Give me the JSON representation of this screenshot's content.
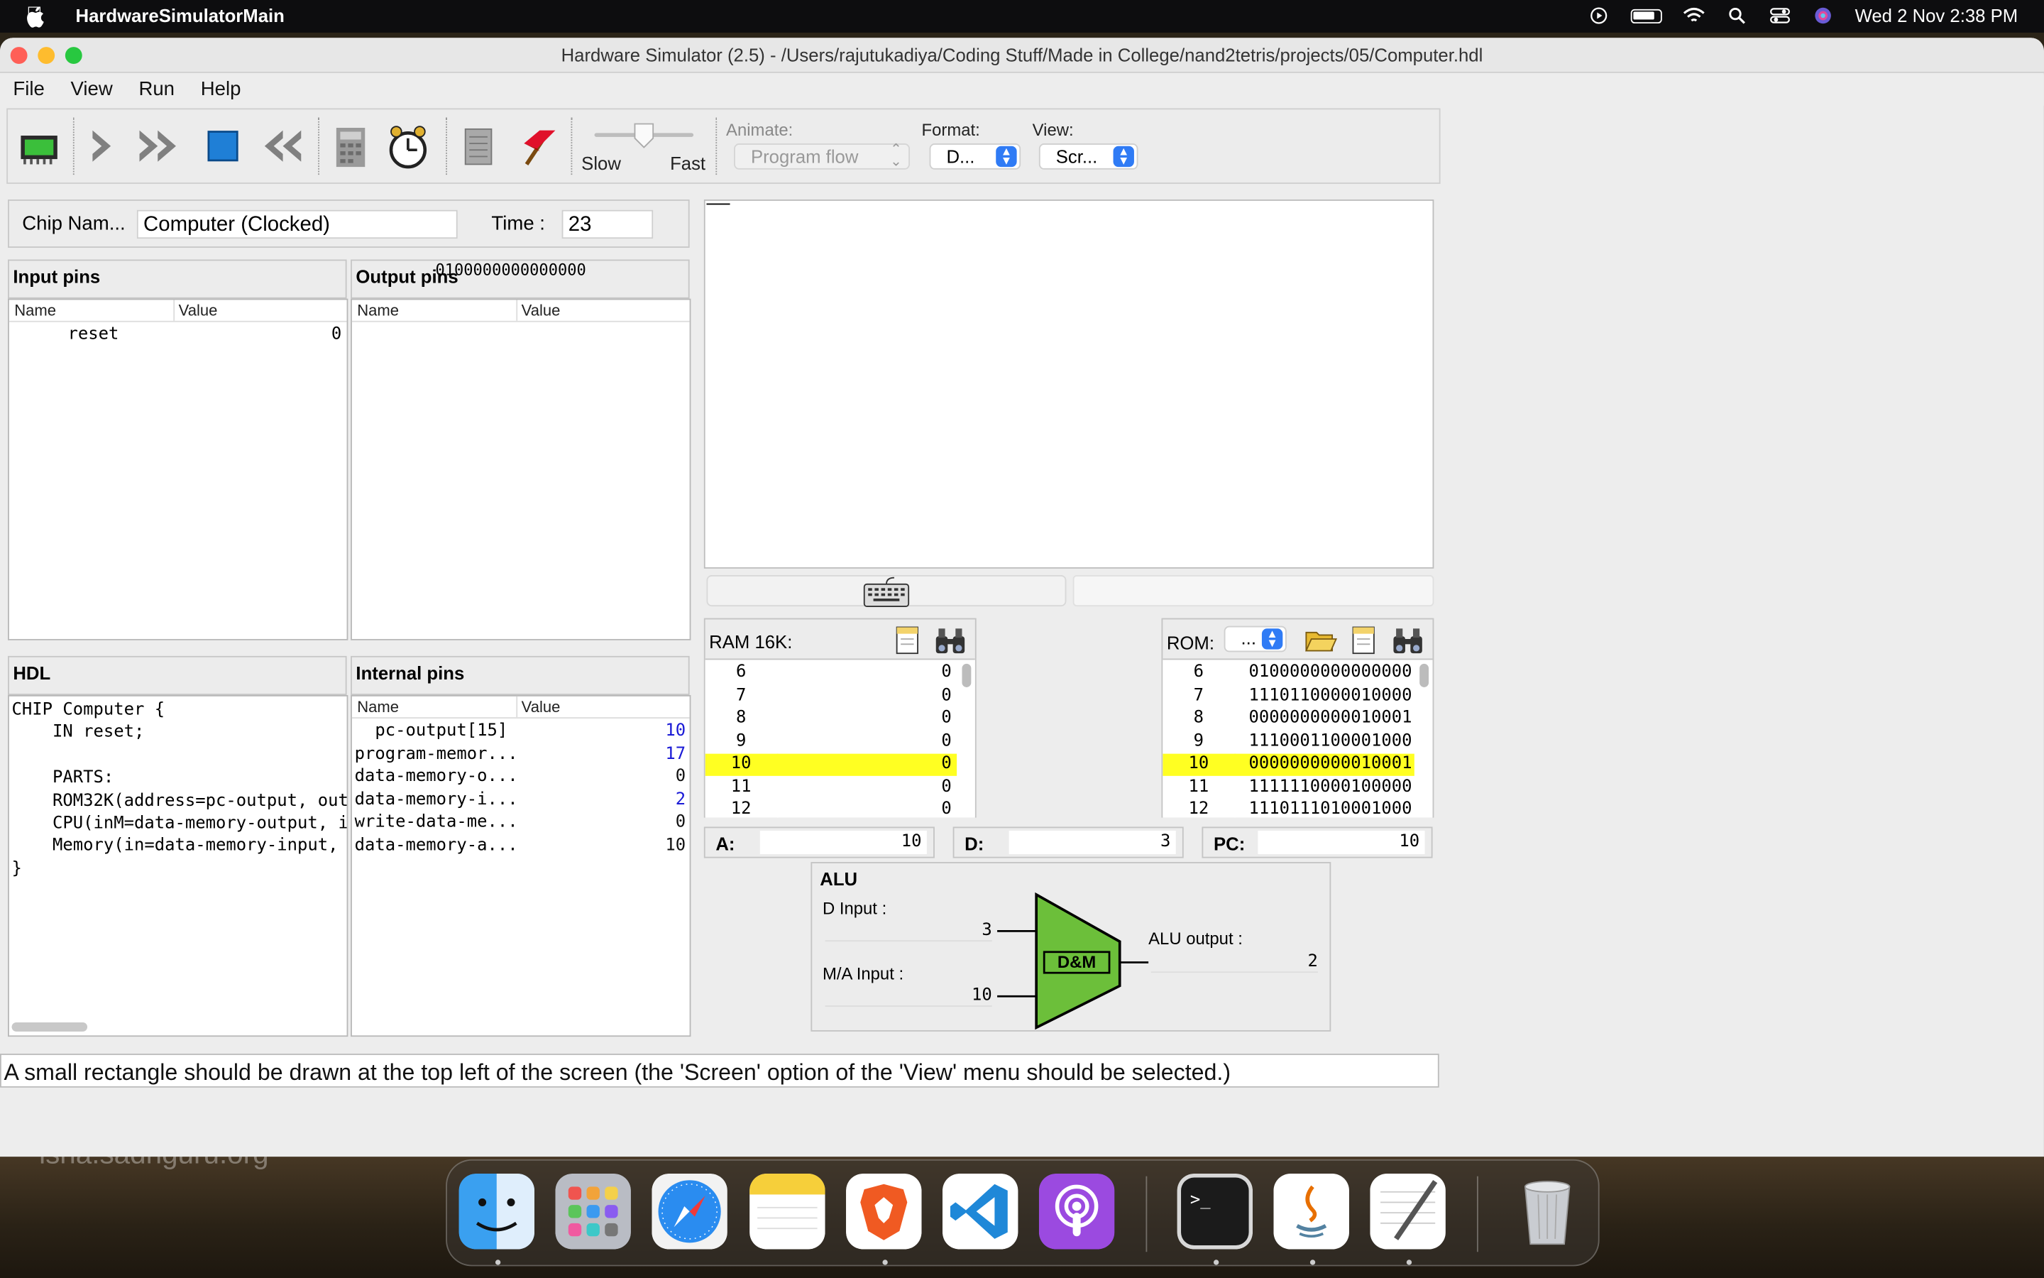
{
  "menubar": {
    "app_name": "HardwareSimulatorMain",
    "datetime": "Wed 2 Nov  2:38 PM",
    "icons": [
      "apple-icon",
      "play-circle-icon",
      "battery-icon",
      "wifi-icon",
      "search-icon",
      "control-center-icon",
      "siri-icon"
    ]
  },
  "window": {
    "title": "Hardware Simulator (2.5) - /Users/rajutukadiya/Coding Stuff/Made in College/nand2tetris/projects/05/Computer.hdl",
    "menus": [
      "File",
      "View",
      "Run",
      "Help"
    ]
  },
  "toolbar": {
    "buttons": [
      "load-chip",
      "single-step",
      "run",
      "stop",
      "rewind",
      "eval",
      "clock",
      "script",
      "breakpoints"
    ],
    "speed_slow": "Slow",
    "speed_fast": "Fast",
    "animate_label": "Animate:",
    "animate_value": "Program flow",
    "format_label": "Format:",
    "format_value": "D...",
    "view_label": "View:",
    "view_value": "Scr..."
  },
  "chip": {
    "name_label": "Chip Nam...",
    "name_value": "Computer (Clocked)",
    "time_label": "Time :",
    "time_value": "23"
  },
  "input_pins": {
    "title": "Input pins",
    "col_name": "Name",
    "col_value": "Value",
    "rows": [
      {
        "name": "reset",
        "value": "0"
      }
    ]
  },
  "output_pins": {
    "title": "Output pins",
    "overlay": "0100000000000000",
    "col_name": "Name",
    "col_value": "Value"
  },
  "hdl": {
    "title": "HDL",
    "lines": [
      "CHIP Computer {",
      "    IN reset;",
      "",
      "    PARTS:",
      "    ROM32K(address=pc-output, out=",
      "    CPU(inM=data-memory-output, in",
      "    Memory(in=data-memory-input, l",
      "}"
    ]
  },
  "internal_pins": {
    "title": "Internal pins",
    "col_name": "Name",
    "col_value": "Value",
    "rows": [
      {
        "name": "  pc-output[15]",
        "value": "10",
        "color": "#1a1ad6"
      },
      {
        "name": "program-memor...",
        "value": "17",
        "color": "#1a1ad6"
      },
      {
        "name": "data-memory-o...",
        "value": "0",
        "color": "#111111"
      },
      {
        "name": "data-memory-i...",
        "value": "2",
        "color": "#1a1ad6"
      },
      {
        "name": "write-data-me...",
        "value": "0",
        "color": "#111111"
      },
      {
        "name": "data-memory-a...",
        "value": "10",
        "color": "#111111"
      }
    ]
  },
  "ram": {
    "title": "RAM 16K:",
    "rows": [
      {
        "addr": "6",
        "value": "0"
      },
      {
        "addr": "7",
        "value": "0"
      },
      {
        "addr": "8",
        "value": "0"
      },
      {
        "addr": "9",
        "value": "0"
      },
      {
        "addr": "10",
        "value": "0"
      },
      {
        "addr": "11",
        "value": "0"
      },
      {
        "addr": "12",
        "value": "0"
      }
    ],
    "highlight_addr": "10"
  },
  "rom": {
    "title": "ROM:",
    "format_value": "...",
    "rows": [
      {
        "addr": "6",
        "value": "0100000000000000"
      },
      {
        "addr": "7",
        "value": "1110110000010000"
      },
      {
        "addr": "8",
        "value": "0000000000010001"
      },
      {
        "addr": "9",
        "value": "1110001100001000"
      },
      {
        "addr": "10",
        "value": "0000000000010001"
      },
      {
        "addr": "11",
        "value": "1111110000100000"
      },
      {
        "addr": "12",
        "value": "1110111010001000"
      }
    ],
    "highlight_addr": "10"
  },
  "registers": {
    "a_label": "A:",
    "a_value": "10",
    "d_label": "D:",
    "d_value": "3",
    "pc_label": "PC:",
    "pc_value": "10"
  },
  "alu": {
    "title": "ALU",
    "d_input_label": "D Input :",
    "d_input_value": "3",
    "ma_input_label": "M/A Input :",
    "ma_input_value": "10",
    "op": "D&M",
    "output_label": "ALU output :",
    "output_value": "2",
    "color": "#6cbf3a"
  },
  "status": {
    "message": "A small rectangle should be drawn at the top left of the screen (the 'Screen' option of the 'View' menu should be selected.)"
  },
  "desktop": {
    "watermark": "isha.sadhguru.org"
  },
  "dock": {
    "apps": [
      "finder",
      "launchpad",
      "safari",
      "notes",
      "brave",
      "vscode",
      "podcasts",
      "terminal",
      "java",
      "textedit",
      "trash"
    ]
  }
}
